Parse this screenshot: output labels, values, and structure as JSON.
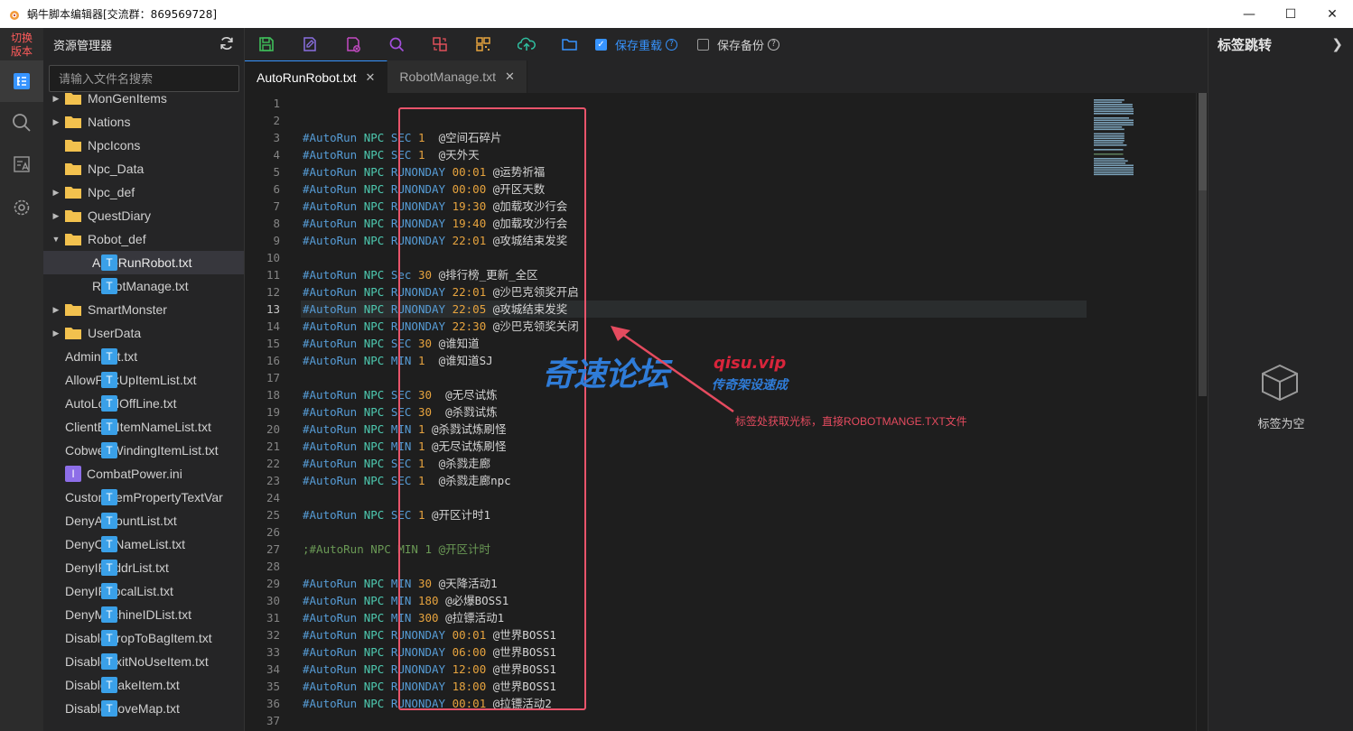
{
  "window": {
    "title": "蜗牛脚本编辑器[交流群：869569728]",
    "minimize": "—",
    "maximize": "☐",
    "close": "✕"
  },
  "activity": {
    "switch_version": "切换\n版本"
  },
  "explorer": {
    "title": "资源管理器",
    "search_placeholder": "请输入文件名搜索",
    "items": [
      {
        "label": "MonGenItems",
        "type": "folder",
        "expanded": false,
        "indent": 0
      },
      {
        "label": "Nations",
        "type": "folder",
        "expanded": false,
        "indent": 0
      },
      {
        "label": "NpcIcons",
        "type": "folder",
        "expanded": null,
        "indent": 0
      },
      {
        "label": "Npc_Data",
        "type": "folder",
        "expanded": null,
        "indent": 0
      },
      {
        "label": "Npc_def",
        "type": "folder",
        "expanded": false,
        "indent": 0
      },
      {
        "label": "QuestDiary",
        "type": "folder",
        "expanded": false,
        "indent": 0
      },
      {
        "label": "Robot_def",
        "type": "folder",
        "expanded": true,
        "indent": 0
      },
      {
        "label": "AutoRunRobot.txt",
        "type": "txt",
        "indent": 1,
        "selected": true
      },
      {
        "label": "RobotManage.txt",
        "type": "txt",
        "indent": 1
      },
      {
        "label": "SmartMonster",
        "type": "folder",
        "expanded": false,
        "indent": 0
      },
      {
        "label": "UserData",
        "type": "folder",
        "expanded": false,
        "indent": 0
      },
      {
        "label": "AdminList.txt",
        "type": "txt",
        "indent": 0
      },
      {
        "label": "AllowPickUpItemList.txt",
        "type": "txt",
        "indent": 0
      },
      {
        "label": "AutoLoadOffLine.txt",
        "type": "txt",
        "indent": 0
      },
      {
        "label": "ClientEatItemNameList.txt",
        "type": "txt",
        "indent": 0
      },
      {
        "label": "CobwebWindingItemList.txt",
        "type": "txt",
        "indent": 0
      },
      {
        "label": "CombatPower.ini",
        "type": "ini",
        "indent": 0
      },
      {
        "label": "CustomItemPropertyTextVar",
        "type": "txt",
        "indent": 0
      },
      {
        "label": "DenyAccountList.txt",
        "type": "txt",
        "indent": 0
      },
      {
        "label": "DenyChrNameList.txt",
        "type": "txt",
        "indent": 0
      },
      {
        "label": "DenyIPAddrList.txt",
        "type": "txt",
        "indent": 0
      },
      {
        "label": "DenyIPLocalList.txt",
        "type": "txt",
        "indent": 0
      },
      {
        "label": "DenyMachineIDList.txt",
        "type": "txt",
        "indent": 0
      },
      {
        "label": "DisableDropToBagItem.txt",
        "type": "txt",
        "indent": 0
      },
      {
        "label": "DisableExitNoUseItem.txt",
        "type": "txt",
        "indent": 0
      },
      {
        "label": "DisableMakeItem.txt",
        "type": "txt",
        "indent": 0
      },
      {
        "label": "DisableMoveMap.txt",
        "type": "txt",
        "indent": 0
      }
    ]
  },
  "toolbar": {
    "save_reload_label": "保存重载",
    "save_reload_checked": true,
    "save_backup_label": "保存备份",
    "save_backup_checked": false
  },
  "tabs": [
    {
      "label": "AutoRunRobot.txt",
      "active": true
    },
    {
      "label": "RobotManage.txt",
      "active": false
    }
  ],
  "editor": {
    "current_line": 13,
    "lines": [
      {
        "n": 1,
        "text": ""
      },
      {
        "n": 2,
        "text": ""
      },
      {
        "n": 3,
        "text": "#AutoRun NPC SEC 1  @空间石碎片"
      },
      {
        "n": 4,
        "text": "#AutoRun NPC SEC 1  @天外天"
      },
      {
        "n": 5,
        "text": "#AutoRun NPC RUNONDAY 00:01 @运势祈福"
      },
      {
        "n": 6,
        "text": "#AutoRun NPC RUNONDAY 00:00 @开区天数"
      },
      {
        "n": 7,
        "text": "#AutoRun NPC RUNONDAY 19:30 @加载攻沙行会"
      },
      {
        "n": 8,
        "text": "#AutoRun NPC RUNONDAY 19:40 @加载攻沙行会"
      },
      {
        "n": 9,
        "text": "#AutoRun NPC RUNONDAY 22:01 @攻城结束发奖"
      },
      {
        "n": 10,
        "text": ""
      },
      {
        "n": 11,
        "text": "#AutoRun NPC Sec 30 @排行榜_更新_全区"
      },
      {
        "n": 12,
        "text": "#AutoRun NPC RUNONDAY 22:01 @沙巴克领奖开启"
      },
      {
        "n": 13,
        "text": "#AutoRun NPC RUNONDAY 22:05 @攻城结束发奖"
      },
      {
        "n": 14,
        "text": "#AutoRun NPC RUNONDAY 22:30 @沙巴克领奖关闭"
      },
      {
        "n": 15,
        "text": "#AutoRun NPC SEC 30 @谁知道"
      },
      {
        "n": 16,
        "text": "#AutoRun NPC MIN 1  @谁知道SJ"
      },
      {
        "n": 17,
        "text": ""
      },
      {
        "n": 18,
        "text": "#AutoRun NPC SEC 30  @无尽试炼"
      },
      {
        "n": 19,
        "text": "#AutoRun NPC SEC 30  @杀戮试炼"
      },
      {
        "n": 20,
        "text": "#AutoRun NPC MIN 1 @杀戮试炼刷怪"
      },
      {
        "n": 21,
        "text": "#AutoRun NPC MIN 1 @无尽试炼刷怪"
      },
      {
        "n": 22,
        "text": "#AutoRun NPC SEC 1  @杀戮走廊"
      },
      {
        "n": 23,
        "text": "#AutoRun NPC SEC 1  @杀戮走廊npc"
      },
      {
        "n": 24,
        "text": ""
      },
      {
        "n": 25,
        "text": "#AutoRun NPC SEC 1 @开区计时1"
      },
      {
        "n": 26,
        "text": ""
      },
      {
        "n": 27,
        "text": ";#AutoRun NPC MIN 1 @开区计时"
      },
      {
        "n": 28,
        "text": ""
      },
      {
        "n": 29,
        "text": "#AutoRun NPC MIN 30 @天降活动1"
      },
      {
        "n": 30,
        "text": "#AutoRun NPC MIN 180 @必爆BOSS1"
      },
      {
        "n": 31,
        "text": "#AutoRun NPC MIN 300 @拉镖活动1"
      },
      {
        "n": 32,
        "text": "#AutoRun NPC RUNONDAY 00:01 @世界BOSS1"
      },
      {
        "n": 33,
        "text": "#AutoRun NPC RUNONDAY 06:00 @世界BOSS1"
      },
      {
        "n": 34,
        "text": "#AutoRun NPC RUNONDAY 12:00 @世界BOSS1"
      },
      {
        "n": 35,
        "text": "#AutoRun NPC RUNONDAY 18:00 @世界BOSS1"
      },
      {
        "n": 36,
        "text": "#AutoRun NPC RUNONDAY 00:01 @拉镖活动2"
      },
      {
        "n": 37,
        "text": ""
      }
    ]
  },
  "overlay": {
    "watermark_main": "奇速论坛",
    "watermark_site": "qisu.vip",
    "watermark_sub": "传奇架设速成",
    "annotation": "标签处获取光标，直接ROBOTMANGE.TXT文件"
  },
  "right_panel": {
    "title": "标签跳转",
    "empty_text": "标签为空"
  },
  "colors": {
    "accent": "#3794ff",
    "annotation_red": "#e54b5f",
    "txt_icon": "#3aa0e8",
    "ini_icon": "#8d6ee8",
    "folder": "#f2c14e"
  }
}
